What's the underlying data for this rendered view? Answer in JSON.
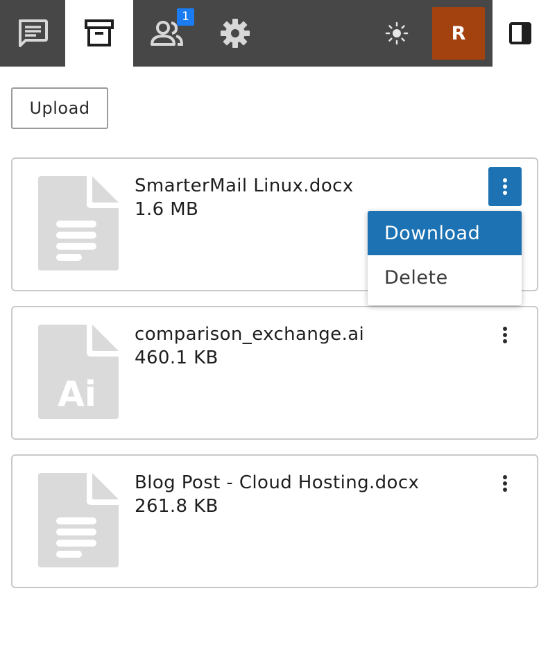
{
  "toolbar": {
    "items": [
      {
        "icon": "chat-icon"
      },
      {
        "icon": "archive-icon",
        "active": true
      },
      {
        "icon": "users-icon",
        "badge": "1"
      },
      {
        "icon": "gear-icon"
      }
    ],
    "theme_icon": "sun-icon",
    "avatar_initial": "R",
    "panel_icon": "sidebar-toggle-icon"
  },
  "upload_label": "Upload",
  "files": [
    {
      "name": "SmarterMail Linux.docx",
      "size": "1.6 MB",
      "icon": "document-icon"
    },
    {
      "name": "comparison_exchange.ai",
      "size": "460.1 KB",
      "icon": "ai-file-icon",
      "icon_text": "Ai"
    },
    {
      "name": "Blog Post - Cloud Hosting.docx",
      "size": "261.8 KB",
      "icon": "document-icon"
    }
  ],
  "context_menu": {
    "items": [
      {
        "label": "Download",
        "selected": true
      },
      {
        "label": "Delete"
      }
    ]
  },
  "colors": {
    "toolbar_bg": "#474747",
    "accent": "#1c72b2",
    "badge": "#1a7cf0",
    "avatar": "#a3410f",
    "file_icon": "#dadada"
  }
}
